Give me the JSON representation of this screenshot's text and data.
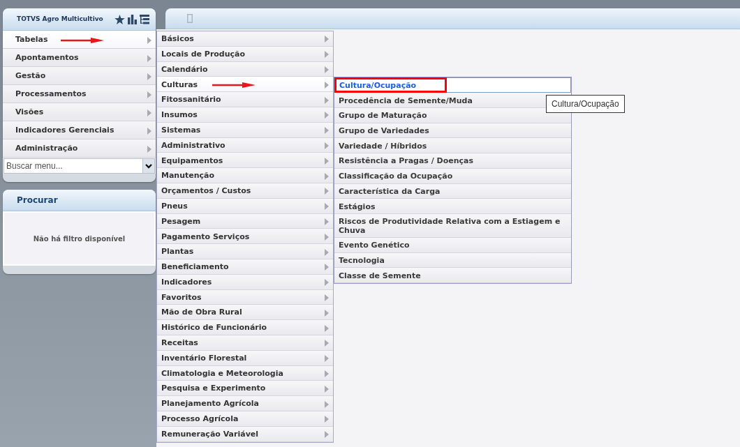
{
  "sidebar": {
    "app_panel": {
      "title": "TOTVS Agro Multicultivo"
    },
    "menu": [
      {
        "label": "Tabelas",
        "selected": true,
        "arrow": true,
        "children": [
          {
            "label": "Básicos",
            "selected": false,
            "arrow": false
          },
          {
            "label": "Locais de Produção",
            "selected": false,
            "arrow": false
          },
          {
            "label": "Calendário",
            "selected": false,
            "arrow": false
          },
          {
            "label": "Culturas",
            "selected": true,
            "arrow": true,
            "children": [
              {
                "label": "Cultura/Ocupação",
                "selected": true,
                "framed": true
              },
              {
                "label": "Procedência de Semente/Muda",
                "selected": false,
                "framed": false
              },
              {
                "label": "Grupo de Maturação",
                "selected": false,
                "framed": false
              },
              {
                "label": "Grupo de Variedades",
                "selected": false,
                "framed": false
              },
              {
                "label": "Variedade / Híbridos",
                "selected": false,
                "framed": false
              },
              {
                "label": "Resistência a Pragas / Doenças",
                "selected": false,
                "framed": false
              },
              {
                "label": "Classificação da Ocupação",
                "selected": false,
                "framed": false
              },
              {
                "label": "Característica da Carga",
                "selected": false,
                "framed": false
              },
              {
                "label": "Estágios",
                "selected": false,
                "framed": false
              },
              {
                "label": "Riscos de Produtividade Relativa com a Estiagem e Chuva",
                "selected": false,
                "framed": false
              },
              {
                "label": "Evento Genético",
                "selected": false,
                "framed": false
              },
              {
                "label": "Tecnologia",
                "selected": false,
                "framed": false
              },
              {
                "label": "Classe de Semente",
                "selected": false,
                "framed": false
              }
            ]
          },
          {
            "label": "Fitossanitário",
            "selected": false,
            "arrow": false
          },
          {
            "label": "Insumos",
            "selected": false,
            "arrow": false
          },
          {
            "label": "Sistemas",
            "selected": false,
            "arrow": false
          },
          {
            "label": "Administrativo",
            "selected": false,
            "arrow": false
          },
          {
            "label": "Equipamentos",
            "selected": false,
            "arrow": false
          },
          {
            "label": "Manutenção",
            "selected": false,
            "arrow": false
          },
          {
            "label": "Orçamentos / Custos",
            "selected": false,
            "arrow": false
          },
          {
            "label": "Pneus",
            "selected": false,
            "arrow": false
          },
          {
            "label": "Pesagem",
            "selected": false,
            "arrow": false
          },
          {
            "label": "Pagamento Serviços",
            "selected": false,
            "arrow": false
          },
          {
            "label": "Plantas",
            "selected": false,
            "arrow": false
          },
          {
            "label": "Beneficiamento",
            "selected": false,
            "arrow": false
          },
          {
            "label": "Indicadores",
            "selected": false,
            "arrow": false
          },
          {
            "label": "Favoritos",
            "selected": false,
            "arrow": false
          },
          {
            "label": "Mão de Obra Rural",
            "selected": false,
            "arrow": false
          },
          {
            "label": "Histórico de Funcionário",
            "selected": false,
            "arrow": false
          },
          {
            "label": "Receitas",
            "selected": false,
            "arrow": false
          },
          {
            "label": "Inventário Florestal",
            "selected": false,
            "arrow": false
          },
          {
            "label": "Climatologia e Meteorologia",
            "selected": false,
            "arrow": false
          },
          {
            "label": "Pesquisa e Experimento",
            "selected": false,
            "arrow": false
          },
          {
            "label": "Planejamento Agrícola",
            "selected": false,
            "arrow": false
          },
          {
            "label": "Processo Agrícola",
            "selected": false,
            "arrow": false
          },
          {
            "label": "Remuneração Variável",
            "selected": false,
            "arrow": false
          }
        ]
      },
      {
        "label": "Apontamentos",
        "selected": false,
        "arrow": false
      },
      {
        "label": "Gestão",
        "selected": false,
        "arrow": false
      },
      {
        "label": "Processamentos",
        "selected": false,
        "arrow": false
      },
      {
        "label": "Visões",
        "selected": false,
        "arrow": false
      },
      {
        "label": "Indicadores Gerenciais",
        "selected": false,
        "arrow": false
      },
      {
        "label": "Administração",
        "selected": false,
        "arrow": false
      }
    ],
    "search": {
      "placeholder": "Buscar menu..."
    }
  },
  "filter_panel": {
    "title": "Procurar",
    "message": "Não há filtro disponível"
  },
  "tooltip": {
    "text": "Cultura/Ocupação"
  }
}
